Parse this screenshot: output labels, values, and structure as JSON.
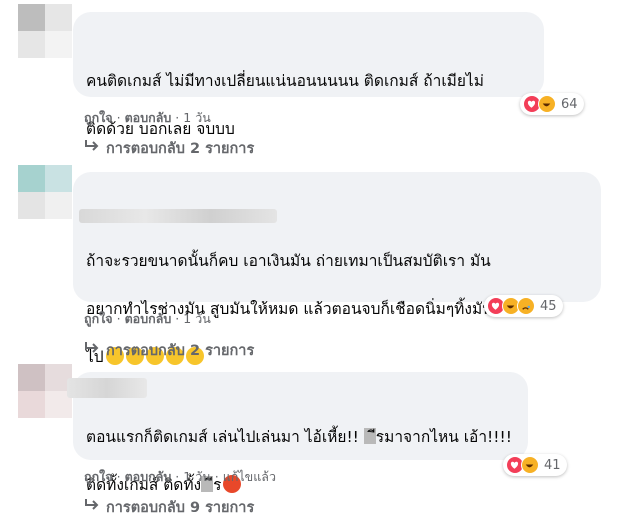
{
  "comments": [
    {
      "text_lines": [
        "คนติดเกมส์ ไม่มีทางเปลี่ยนแน่นอนนนนน ติดเกมส์ ถ้าเมียไม่",
        "ติดด้วย บอกเลย จบบบ"
      ],
      "like_label": "ถูกใจ",
      "reply_label": "ตอบกลับ",
      "time": "1 วัน",
      "reaction_count": "64",
      "replies_label": "การตอบกลับ 2 รายการ"
    },
    {
      "text_lines": [
        "ถ้าจะรวยขนาดนั้นก็คบ เอาเงินมัน ถ่ายเทมาเป็นสมบัติเรา มัน",
        "อยากทำไรช่างมัน สูบมันให้หมด แล้วตอนจบก็เชือดนิ่มๆทิ้งมัน",
        "ไป"
      ],
      "like_label": "ถูกใจ",
      "reply_label": "ตอบกลับ",
      "time": "1 วัน",
      "reaction_count": "45",
      "replies_label": "การตอบกลับ 2 รายการ"
    },
    {
      "text_line1_a": "ตอนแรกก็ติดเกมส์ เล่นไปเล่นมา ไอ้เหี้ย!! ",
      "text_line1_b": "ีรมาจากไหน เอ้า!!!!",
      "text_line2_a": "ติดทั้งเกมส์ ติดทั้ง",
      "text_line2_b": "ีร",
      "like_label": "ถูกใจ",
      "reply_label": "ตอบกลับ",
      "time": "1 วัน",
      "edited_label": "แก้ไขแล้ว",
      "reaction_count": "41",
      "replies_label": "การตอบกลับ 9 รายการ"
    }
  ],
  "icons": {
    "reply_arrow": "reply-arrow-icon",
    "like": "like-reaction-icon",
    "love": "love-reaction-icon",
    "haha": "haha-reaction-icon",
    "sad": "sad-reaction-icon",
    "angry": "angry-reaction-icon"
  },
  "colors": {
    "bubble": "#f0f2f5",
    "meta_text": "#65676b",
    "like_blue": "#1877f2",
    "love_red": "#f33e58"
  }
}
